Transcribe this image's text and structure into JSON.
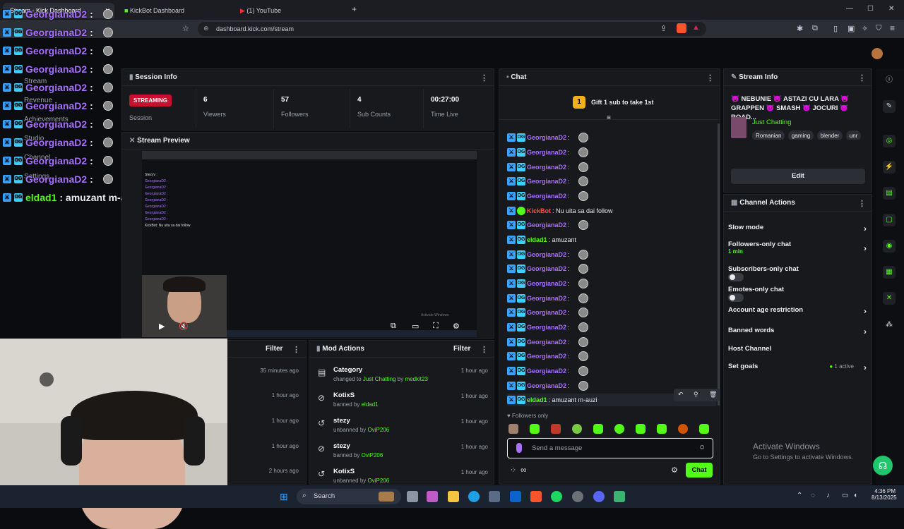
{
  "browser": {
    "tabs": [
      "Stream - Kick Dashboard",
      "KickBot Dashboard",
      "(1) YouTube"
    ],
    "new_tab": "+",
    "url": "dashboard.kick.com/stream",
    "window_controls": [
      "—",
      "☐",
      "✕"
    ]
  },
  "sidebar_left": {
    "items": [
      "Stream",
      "Revenue",
      "Achievements",
      "Studio",
      "Channel",
      "Settings"
    ]
  },
  "overlay_chat": {
    "lines": [
      {
        "user": "GeorgianaD2",
        "text": ":"
      },
      {
        "user": "GeorgianaD2",
        "text": ":"
      },
      {
        "user": "GeorgianaD2",
        "text": ":"
      },
      {
        "user": "GeorgianaD2",
        "text": ":"
      },
      {
        "user": "GeorgianaD2",
        "text": ":"
      },
      {
        "user": "GeorgianaD2",
        "text": ":"
      },
      {
        "user": "GeorgianaD2",
        "text": ":"
      },
      {
        "user": "GeorgianaD2",
        "text": ":"
      },
      {
        "user": "GeorgianaD2",
        "text": ":"
      },
      {
        "user": "GeorgianaD2",
        "text": ":"
      },
      {
        "user": "eldad1",
        "text": ": amuzant m-auzi"
      }
    ]
  },
  "session_info": {
    "title": "Session Info",
    "status": "STREAMING",
    "status_label": "Session",
    "stats": [
      {
        "value": "6",
        "label": "Viewers"
      },
      {
        "value": "57",
        "label": "Followers"
      },
      {
        "value": "4",
        "label": "Sub Counts"
      },
      {
        "value": "00:27:00",
        "label": "Time Live"
      }
    ]
  },
  "stream_preview": {
    "title": "Stream Preview",
    "mini_lines": [
      "Stezyv : ",
      "GeorgianaD2 :",
      "GeorgianaD2 :",
      "GeorgianaD2 :",
      "GeorgianaD2 :",
      "GeorgianaD2 :",
      "GeorgianaD2 :",
      "GeorgianaD2 :",
      "KickBot: Nu uita sa dai follow"
    ],
    "watermark": "Activate Windows"
  },
  "filter_panel_left": {
    "filter_label": "Filter",
    "times": [
      "35 minutes ago",
      "1 hour ago",
      "1 hour ago",
      "1 hour ago",
      "2 hours ago"
    ]
  },
  "mod_actions": {
    "title": "Mod Actions",
    "filter_label": "Filter",
    "items": [
      {
        "title": "Category",
        "pre": "changed to",
        "target": "Just Chatting",
        "mid": "by",
        "actor": "medkit23",
        "time": "1 hour ago"
      },
      {
        "title": "KotixS",
        "pre": "banned by",
        "target": "",
        "mid": "",
        "actor": "eldad1",
        "time": "1 hour ago"
      },
      {
        "title": "stezy",
        "pre": "unbanned by",
        "target": "",
        "mid": "",
        "actor": "OviP206",
        "time": "1 hour ago"
      },
      {
        "title": "stezy",
        "pre": "banned by",
        "target": "",
        "mid": "",
        "actor": "OviP206",
        "time": "1 hour ago"
      },
      {
        "title": "KotixS",
        "pre": "unbanned by",
        "target": "",
        "mid": "",
        "actor": "OviP206",
        "time": "1 hour ago"
      }
    ]
  },
  "chat": {
    "title": "Chat",
    "gift_banner": "Gift 1 sub to take 1st",
    "gift_count": "1",
    "messages": [
      {
        "user": "GeorgianaD2",
        "text": ":"
      },
      {
        "user": "GeorgianaD2",
        "text": ":"
      },
      {
        "user": "GeorgianaD2",
        "text": ":"
      },
      {
        "user": "GeorgianaD2",
        "text": ":"
      },
      {
        "user": "GeorgianaD2",
        "text": ":"
      },
      {
        "user": "KickBot",
        "text": ": Nu uita sa dai follow"
      },
      {
        "user": "GeorgianaD2",
        "text": ":"
      },
      {
        "user": "eldad1",
        "text": ": amuzant"
      },
      {
        "user": "GeorgianaD2",
        "text": ":"
      },
      {
        "user": "GeorgianaD2",
        "text": ":"
      },
      {
        "user": "GeorgianaD2",
        "text": ":"
      },
      {
        "user": "GeorgianaD2",
        "text": ":"
      },
      {
        "user": "GeorgianaD2",
        "text": ":"
      },
      {
        "user": "GeorgianaD2",
        "text": ":"
      },
      {
        "user": "GeorgianaD2",
        "text": ":"
      },
      {
        "user": "GeorgianaD2",
        "text": ":"
      },
      {
        "user": "GeorgianaD2",
        "text": ":"
      },
      {
        "user": "GeorgianaD2",
        "text": ":"
      },
      {
        "user": "eldad1",
        "text": ": amuzant m-auzi"
      }
    ],
    "followers_only": "Followers only",
    "input_placeholder": "Send a message",
    "send_label": "Chat"
  },
  "stream_info": {
    "title": "Stream Info",
    "stream_title": "😈 NEBUNIE 😈 ASTAZI CU LARA 😈 GRAPPEN 😈 SMASH 😈 JOCURI 😈 ROAD...",
    "category": "Just Chatting",
    "tags": [
      "Romanian",
      "gaming",
      "blender",
      "unr"
    ],
    "edit_label": "Edit"
  },
  "channel_actions": {
    "title": "Channel Actions",
    "items": [
      {
        "label": "Slow mode",
        "kind": "chevron"
      },
      {
        "label": "Followers-only chat",
        "sub": "1 min",
        "kind": "chevron"
      },
      {
        "label": "Subscribers-only chat",
        "kind": "toggle"
      },
      {
        "label": "Emotes-only chat",
        "kind": "toggle"
      },
      {
        "label": "Account age restriction",
        "kind": "chevron"
      },
      {
        "label": "Banned words",
        "kind": "chevron"
      },
      {
        "label": "Host Channel",
        "kind": "none"
      },
      {
        "label": "Set goals",
        "sub": "1 active",
        "kind": "chevron"
      }
    ]
  },
  "watermark": {
    "line1": "Activate Windows",
    "line2": "Go to Settings to activate Windows."
  },
  "taskbar": {
    "search_label": "Search",
    "time": "4:36 PM",
    "date": "8/13/2025"
  },
  "colors": {
    "kick_green": "#53fc18",
    "username_purple": "#a970ff",
    "streaming_red": "#c8102e",
    "panel_bg": "#17191d"
  }
}
